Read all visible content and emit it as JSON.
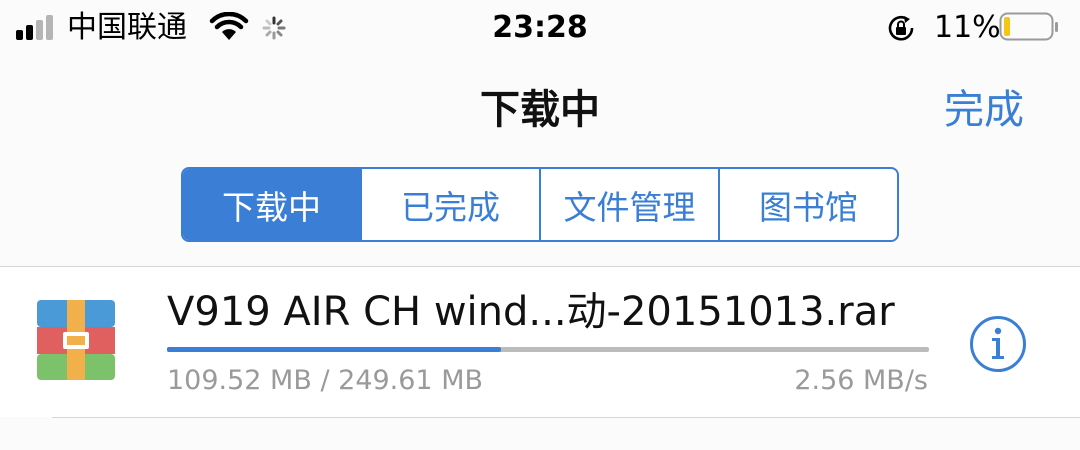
{
  "status_bar": {
    "carrier": "中国联通",
    "time": "23:28",
    "battery_percent": "11%"
  },
  "nav": {
    "title": "下载中",
    "done_label": "完成"
  },
  "tabs": [
    {
      "label": "下载中",
      "selected": true
    },
    {
      "label": "已完成",
      "selected": false
    },
    {
      "label": "文件管理",
      "selected": false
    },
    {
      "label": "图书馆",
      "selected": false
    }
  ],
  "downloads": [
    {
      "file_name": "V919 AIR CH wind...动-20151013.rar",
      "size_progress": "109.52 MB / 249.61 MB",
      "speed": "2.56 MB/s",
      "progress_fraction": 0.4388,
      "icon": "archive-rar-icon"
    }
  ],
  "colors": {
    "accent": "#3a7fd5",
    "secondary_text": "#9a9a9a",
    "battery_low": "#f5c518"
  }
}
